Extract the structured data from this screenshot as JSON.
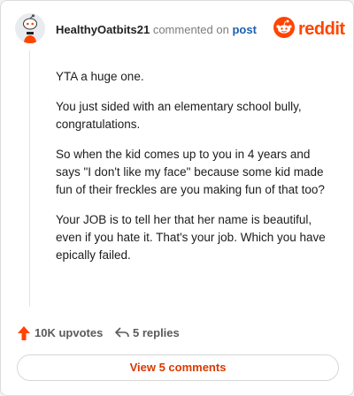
{
  "header": {
    "username": "HealthyOatbits21",
    "action_text": "commented on",
    "post_link": "post",
    "brand": "reddit",
    "brand_color": "#ff4500",
    "avatar_icon": "snoo-avatar-icon"
  },
  "comment": {
    "paragraphs": [
      "YTA a huge one.",
      "You just sided with an elementary school bully, congratulations.",
      "So when the kid comes up to you in 4 years and says \"I don't like my face\" because some kid made fun of their freckles are you making fun of that too?",
      "Your JOB is to tell her that her name is beautiful, even if you hate it. That's your job. Which you have epically failed."
    ]
  },
  "actions": {
    "upvotes_label": "10K upvotes",
    "replies_label": "5 replies",
    "upvote_icon": "upvote-arrow-icon",
    "reply_icon": "reply-arrow-icon",
    "upvote_color": "#ff4500"
  },
  "footer": {
    "view_button_label": "View 5 comments",
    "button_text_color": "#d93a00"
  }
}
